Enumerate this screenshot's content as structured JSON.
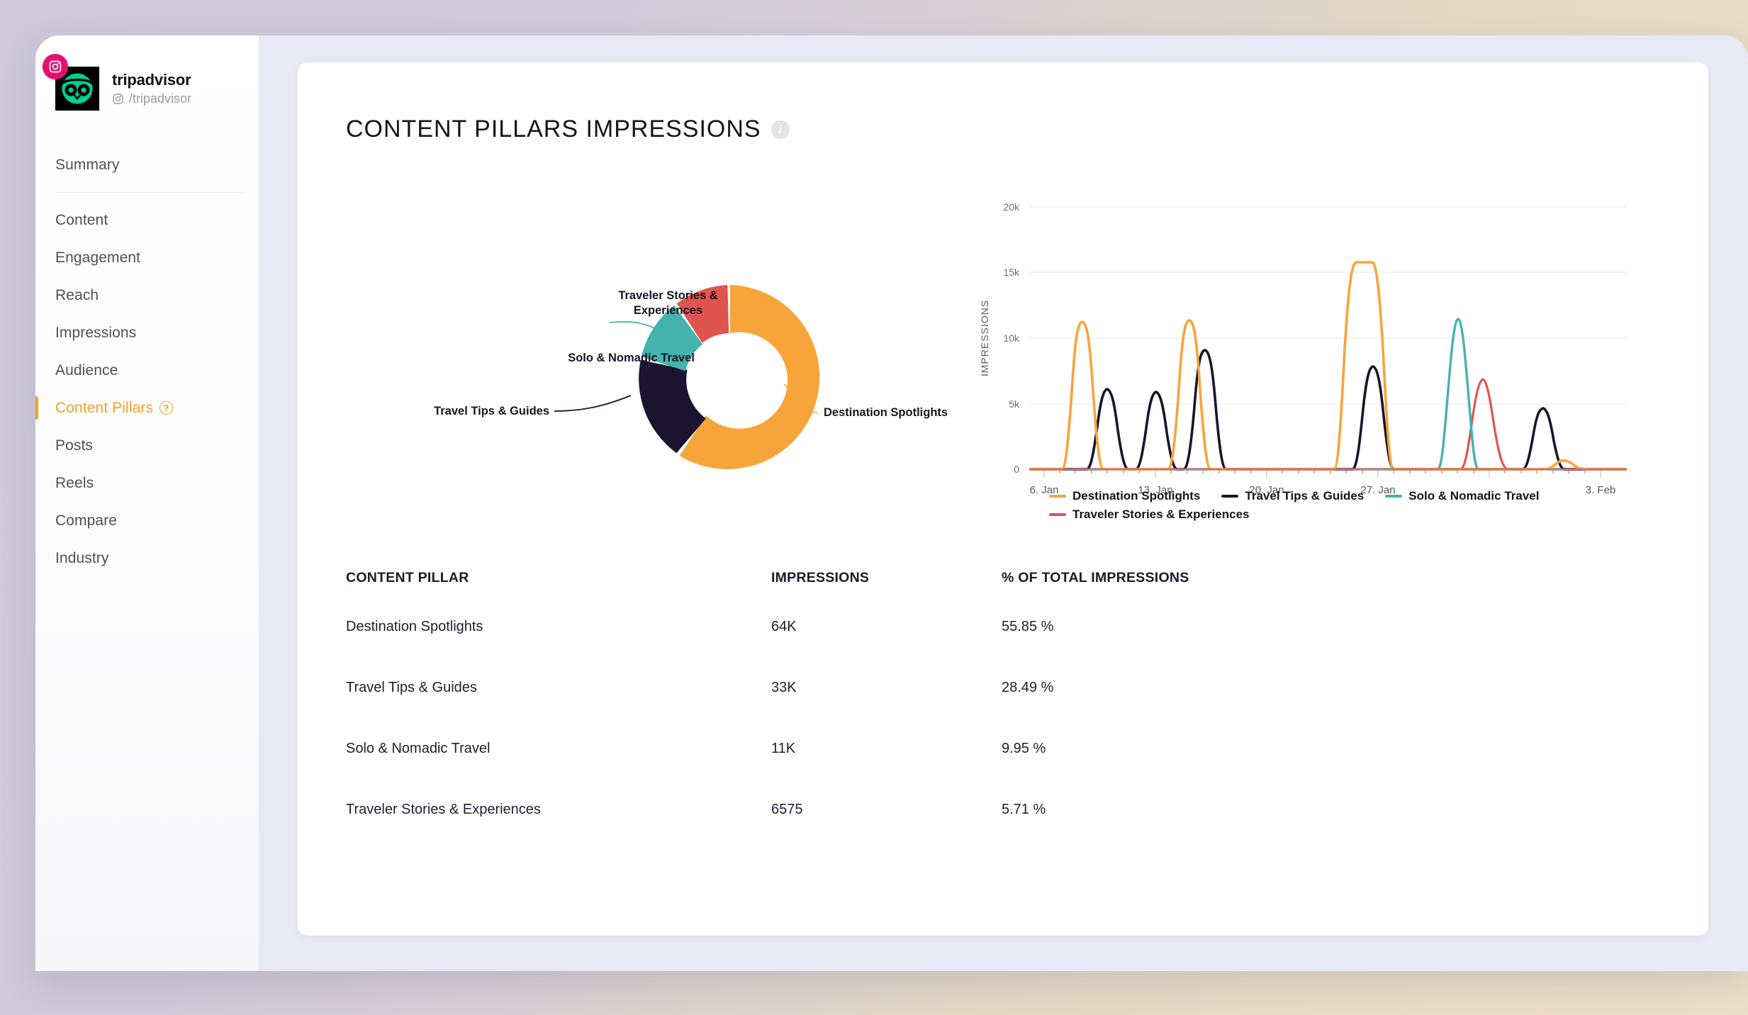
{
  "profile": {
    "name": "tripadvisor",
    "handle": "/tripadvisor",
    "platform_icon": "instagram-icon",
    "avatar_icon": "tripadvisor-owl-logo"
  },
  "sidebar": {
    "items": [
      {
        "label": "Summary",
        "active": false
      },
      {
        "label": "Content",
        "active": false
      },
      {
        "label": "Engagement",
        "active": false
      },
      {
        "label": "Reach",
        "active": false
      },
      {
        "label": "Impressions",
        "active": false
      },
      {
        "label": "Audience",
        "active": false
      },
      {
        "label": "Content Pillars",
        "active": true,
        "help_icon": "question-mark-icon"
      },
      {
        "label": "Posts",
        "active": false
      },
      {
        "label": "Reels",
        "active": false
      },
      {
        "label": "Compare",
        "active": false
      },
      {
        "label": "Industry",
        "active": false
      }
    ]
  },
  "header": {
    "title": "CONTENT PILLARS IMPRESSIONS",
    "info_icon": "info-icon"
  },
  "colors": {
    "destination_spotlights": "#f7a53a",
    "travel_tips_guides": "#1a142e",
    "solo_nomadic_travel": "#45b3ad",
    "traveler_stories_experiences": "#e0544f",
    "accent": "#f5a028",
    "frame": "#e7eaf4",
    "card": "#ffffff"
  },
  "chart_data": [
    {
      "type": "pie",
      "title": "",
      "variant": "donut",
      "labels": [
        "Destination Spotlights",
        "Travel Tips & Guides",
        "Solo & Nomadic Travel",
        "Traveler Stories & Experiences"
      ],
      "values": [
        55.85,
        28.49,
        9.95,
        5.71
      ],
      "colors": [
        "#f7a53a",
        "#1a142e",
        "#45b3ad",
        "#e0544f"
      ],
      "legend": "callout-labels",
      "start_angle": 0,
      "direction": "clockwise"
    },
    {
      "type": "line",
      "title": "",
      "xlabel": "",
      "ylabel": "IMPRESSIONS",
      "ylim": [
        0,
        20000
      ],
      "yticks": [
        0,
        5000,
        10000,
        15000,
        20000
      ],
      "ytick_labels": [
        "0",
        "5k",
        "10k",
        "15k",
        "20k"
      ],
      "xticks": [
        "6. Jan",
        "13. Jan",
        "20. Jan",
        "27. Jan",
        "3. Feb"
      ],
      "xlim": [
        "4. Jan",
        "4. Feb"
      ],
      "grid": true,
      "legend_position": "bottom-left",
      "series": [
        {
          "name": "Destination Spotlights",
          "color": "#f7a53a",
          "peaks": [
            {
              "x": "8. Jan",
              "y": 11200
            },
            {
              "x": "15. Jan",
              "y": 11300
            },
            {
              "x": "24. Jan",
              "y": 15700
            },
            {
              "x": "31. Jan",
              "y": 520
            }
          ]
        },
        {
          "name": "Travel Tips & Guides",
          "color": "#1a142e",
          "peaks": [
            {
              "x": "10. Jan",
              "y": 6050
            },
            {
              "x": "13. Jan",
              "y": 5800
            },
            {
              "x": "15. Jan",
              "y": 9000
            },
            {
              "x": "25. Jan",
              "y": 7800
            },
            {
              "x": "1. Feb",
              "y": 4500
            }
          ]
        },
        {
          "name": "Solo & Nomadic Travel",
          "color": "#45b3ad",
          "peaks": [
            {
              "x": "27. Jan",
              "y": 11400
            }
          ]
        },
        {
          "name": "Traveler Stories & Experiences",
          "color": "#e0544f",
          "peaks": [
            {
              "x": "28. Jan",
              "y": 6700
            }
          ]
        }
      ]
    }
  ],
  "table": {
    "headers": [
      "CONTENT PILLAR",
      "IMPRESSIONS",
      "% OF TOTAL IMPRESSIONS"
    ],
    "rows": [
      {
        "pillar": "Destination Spotlights",
        "impressions": "64K",
        "percent": "55.85 %"
      },
      {
        "pillar": "Travel Tips & Guides",
        "impressions": "33K",
        "percent": "28.49 %"
      },
      {
        "pillar": "Solo & Nomadic Travel",
        "impressions": "11K",
        "percent": "9.95 %"
      },
      {
        "pillar": "Traveler Stories & Experiences",
        "impressions": "6575",
        "percent": "5.71 %"
      }
    ]
  }
}
